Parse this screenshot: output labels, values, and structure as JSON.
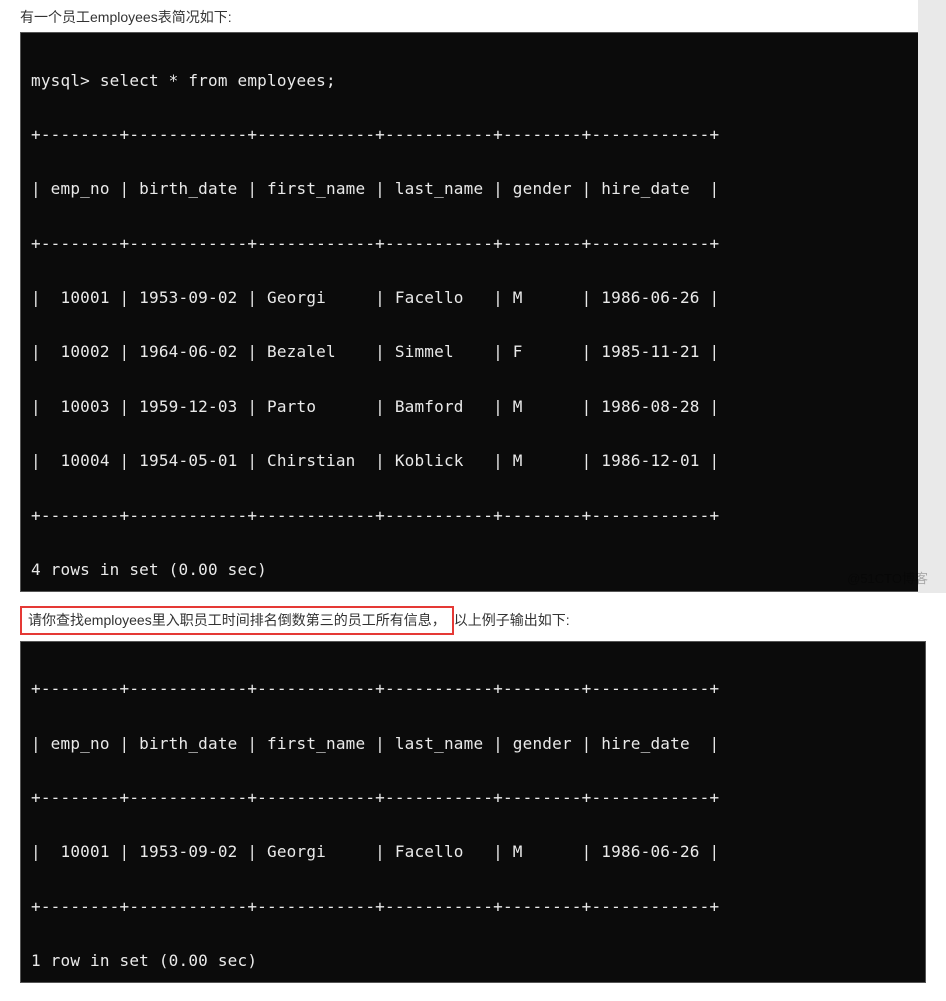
{
  "intro": {
    "text": "有一个员工employees表简况如下:"
  },
  "terminal1": {
    "command": "mysql> select * from employees;",
    "divider": "+--------+------------+------------+-----------+--------+------------+",
    "header": "| emp_no | birth_date | first_name | last_name | gender | hire_date  |",
    "rows": [
      "|  10001 | 1953-09-02 | Georgi     | Facello   | M      | 1986-06-26 |",
      "|  10002 | 1964-06-02 | Bezalel    | Simmel    | F      | 1985-11-21 |",
      "|  10003 | 1959-12-03 | Parto      | Bamford   | M      | 1986-08-28 |",
      "|  10004 | 1954-05-01 | Chirstian  | Koblick   | M      | 1986-12-01 |"
    ],
    "footer": "4 rows in set (0.00 sec)"
  },
  "question": {
    "highlighted": "请你查找employees里入职员工时间排名倒数第三的员工所有信息，",
    "suffix": "以上例子输出如下:"
  },
  "terminal2": {
    "divider": "+--------+------------+------------+-----------+--------+------------+",
    "header": "| emp_no | birth_date | first_name | last_name | gender | hire_date  |",
    "rows": [
      "|  10001 | 1953-09-02 | Georgi     | Facello   | M      | 1986-06-26 |"
    ],
    "footer": "1 row in set (0.00 sec)"
  },
  "watermark": "@51CTO博客"
}
